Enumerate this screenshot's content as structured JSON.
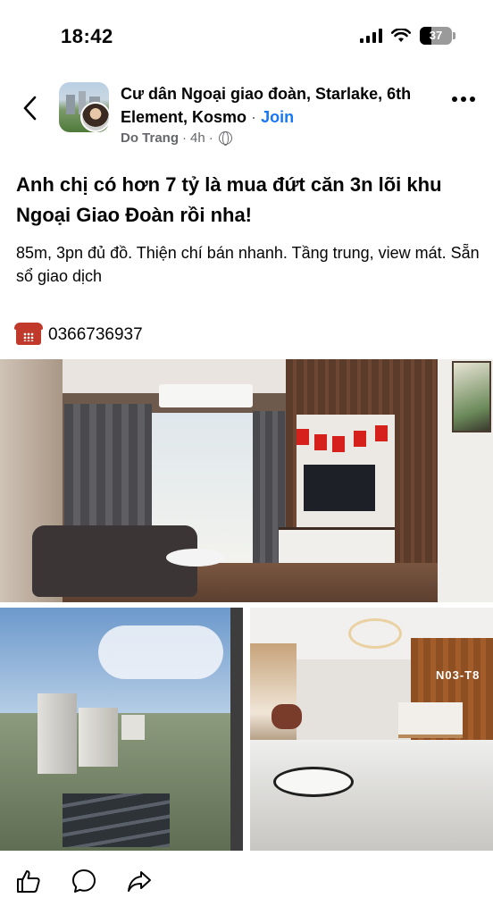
{
  "status_bar": {
    "time": "18:42",
    "battery_text": "37",
    "battery_level": 0.37
  },
  "header": {
    "group_name": "Cư dân Ngoại giao đoàn, Starlake, 6th Element, Kosmo",
    "join_label": "Join",
    "separator": "·",
    "author": "Do Trang",
    "time_ago": "4h",
    "icons": {
      "back": "chevron-left-icon",
      "privacy": "globe-icon",
      "more": "more-horizontal-icon"
    }
  },
  "post": {
    "title": "Anh chị có hơn 7 tỷ là mua đứt căn 3n lõi khu Ngoại Giao Đoàn rồi nha!",
    "body": "85m, 3pn đủ đồ. Thiện chí bán nhanh. Tầng trung, view mát. Sẵn sổ giao dịch",
    "phone": "0366736937",
    "phone_icon": "telephone-icon"
  },
  "photos": {
    "lobby_sign": "N03-T8"
  },
  "actions": {
    "icons": [
      "like-icon",
      "comment-icon",
      "share-icon"
    ]
  },
  "colors": {
    "accent": "#1877f2",
    "meta": "#65676b",
    "text": "#050505"
  }
}
